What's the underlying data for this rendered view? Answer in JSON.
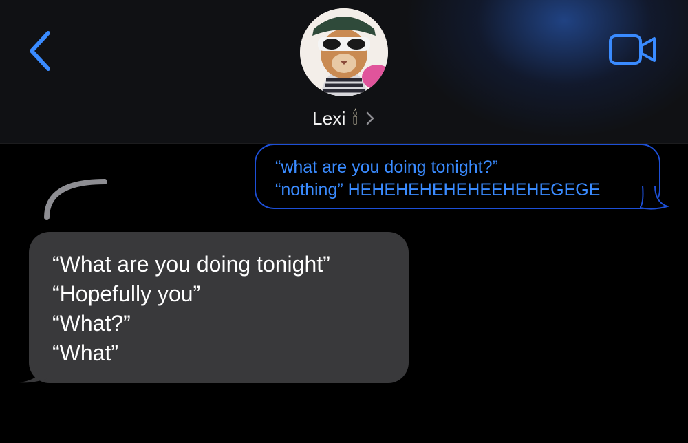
{
  "header": {
    "contact_name": "Lexi",
    "contact_emoji": "🕯",
    "back_icon": "chevron-left-icon",
    "video_icon": "video-camera-icon",
    "chevron_icon": "chevron-right-icon",
    "accent_color": "#3a8bff"
  },
  "messages": [
    {
      "direction": "sent",
      "style": "outlined",
      "lines": [
        "“what are you doing tonight?”",
        "“nothing” HEHEHEHEHEHEEHEHEGEGE"
      ]
    },
    {
      "direction": "received",
      "lines": [
        "“What are you doing tonight”",
        "“Hopefully you”",
        "“What?”",
        "“What”"
      ]
    }
  ]
}
